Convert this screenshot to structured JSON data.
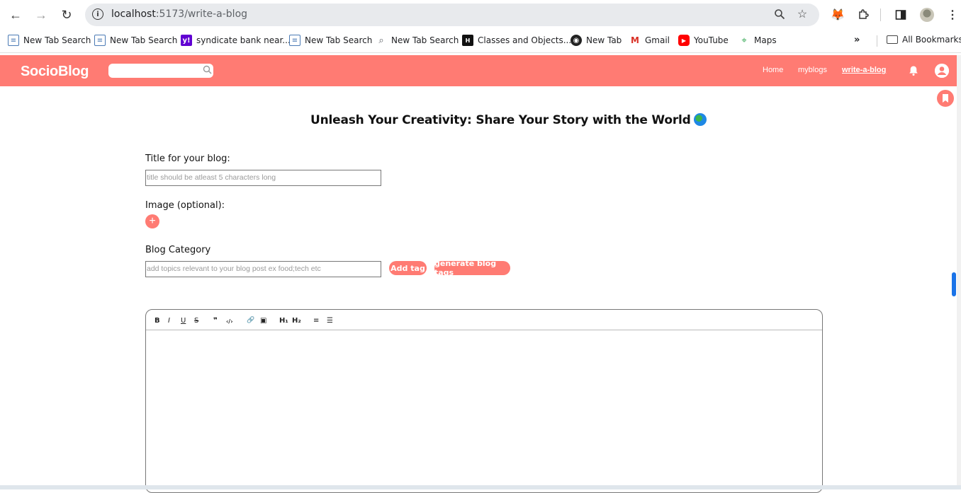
{
  "browser": {
    "url_host": "localhost",
    "url_path": ":5173/write-a-blog",
    "bookmarks": [
      {
        "label": "New Tab Search",
        "icon": "page-icon"
      },
      {
        "label": "New Tab Search",
        "icon": "page-icon"
      },
      {
        "label": "syndicate bank near...",
        "icon": "yahoo-icon"
      },
      {
        "label": "New Tab Search",
        "icon": "page-icon"
      },
      {
        "label": "New Tab Search",
        "icon": "search-icon"
      },
      {
        "label": "Classes and Objects...",
        "icon": "gfg-icon"
      },
      {
        "label": "New Tab",
        "icon": "globe-icon"
      },
      {
        "label": "Gmail",
        "icon": "gmail-icon"
      },
      {
        "label": "YouTube",
        "icon": "youtube-icon"
      },
      {
        "label": "Maps",
        "icon": "maps-icon"
      }
    ],
    "all_bookmarks": "All Bookmarks"
  },
  "app": {
    "logo": "SocioBlog",
    "nav": {
      "home": "Home",
      "myblogs": "myblogs",
      "write": "write-a-blog"
    },
    "accent_color": "#ff7b73"
  },
  "form": {
    "page_title": "Unleash Your Creativity: Share Your Story with the World",
    "title_label": "Title for your blog:",
    "title_placeholder": "title should be atleast 5 characters long",
    "image_label": "Image (optional):",
    "category_label": "Blog Category",
    "category_placeholder": "add topics relevant to your blog post ex food;tech etc",
    "add_tag": "Add tag",
    "generate_tags": "generate blog tags"
  },
  "editor_toolbar": {
    "bold": "B",
    "italic": "I",
    "underline": "U",
    "strike": "S",
    "quote": "❞",
    "code": "‹/›",
    "link": "🔗",
    "image": "▣",
    "h1": "H₁",
    "h2": "H₂",
    "ordered_list": "≡",
    "bullet_list": "☰"
  }
}
